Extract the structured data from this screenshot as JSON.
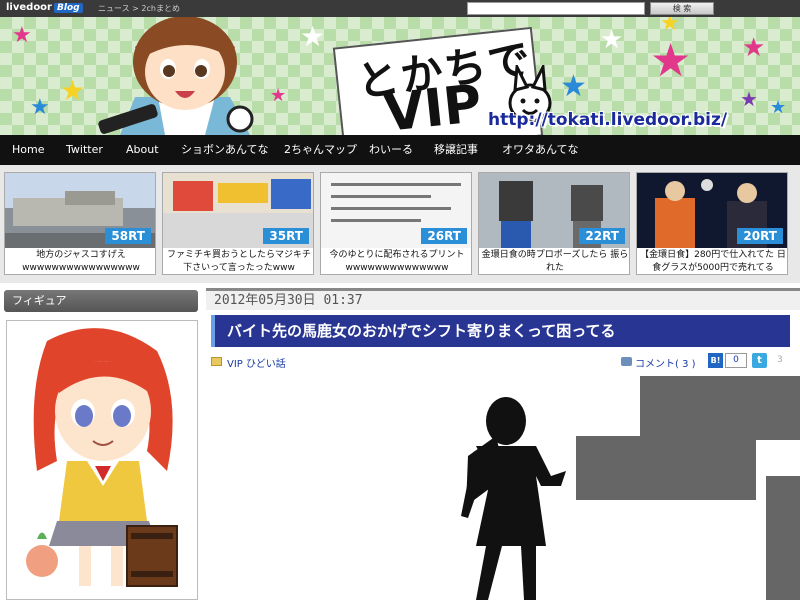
{
  "topbar": {
    "logo": "livedoor",
    "logo_badge": "Blog",
    "breadcrumb": "ニュース > 2chまとめ",
    "search_placeholder": "",
    "search_button": "検 索"
  },
  "banner": {
    "title": "とかちで",
    "title_vip": "VIP",
    "url": "http://tokati.livedoor.biz/",
    "star_colors": [
      "#e2388c",
      "#f5d224",
      "#2a8ad8",
      "#ffffff"
    ]
  },
  "nav": {
    "items": [
      "Home",
      "Twitter",
      "About",
      "ショボンあんてな",
      "2ちゃんマップ",
      "わいーる",
      "移譲記事",
      "オワタあんてな"
    ]
  },
  "popular": [
    {
      "rt": "58RT",
      "caption": "地方のジャスコすげえ wwwwwwwwwwwwwwww"
    },
    {
      "rt": "35RT",
      "caption": "ファミチキ買おうとしたらマジキチ 下さいって言ったったwww"
    },
    {
      "rt": "26RT",
      "caption": "今のゆとりに配布されるプリント wwwwwwwwwwwwww"
    },
    {
      "rt": "22RT",
      "caption": "金環日食の時プロポーズしたら 振られた"
    },
    {
      "rt": "20RT",
      "caption": "【金環日食】280円で仕入れてた 日食グラスが5000円で売れてる"
    }
  ],
  "sidebar": {
    "heading": "フィギュア"
  },
  "article": {
    "date": "2012年05月30日 01:37",
    "title": "バイト先の馬鹿女のおかげでシフト寄りまくって困ってる",
    "category": "VIP ひどい話",
    "comments": "コメント( 3 )",
    "hatena_label": "B!",
    "hatena_count": "0",
    "twitter_label": "t",
    "twitter_count": "3"
  },
  "colors": {
    "nav_bg": "#111111",
    "title_bg": "#283593",
    "rt_badge": "#2b8fd8"
  }
}
